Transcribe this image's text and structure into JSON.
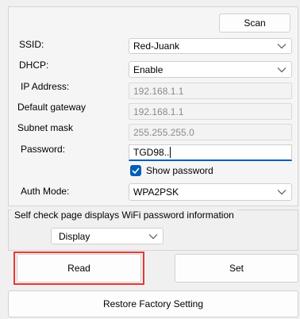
{
  "scan_button": "Scan",
  "fields": {
    "ssid": {
      "label": "SSID:",
      "value": "Red-Juank"
    },
    "dhcp": {
      "label": "DHCP:",
      "value": "Enable"
    },
    "ip": {
      "label": "IP Address:",
      "value": "192.168.1.1"
    },
    "gateway": {
      "label": "Default gateway",
      "value": "192.168.1.1"
    },
    "subnet": {
      "label": "Subnet mask",
      "value": "255.255.255.0"
    },
    "password": {
      "label": "Password:",
      "value": "TGD98.."
    },
    "show_password": {
      "label": "Show password",
      "checked": true
    },
    "auth_mode": {
      "label": "Auth Mode:",
      "value": "WPA2PSK"
    }
  },
  "self_check": {
    "title": "Self check page displays WiFi password information",
    "value": "Display"
  },
  "buttons": {
    "read": "Read",
    "set": "Set",
    "restore": "Restore Factory Setting"
  },
  "colors": {
    "accent": "#005fb8",
    "highlight": "#e53935"
  }
}
